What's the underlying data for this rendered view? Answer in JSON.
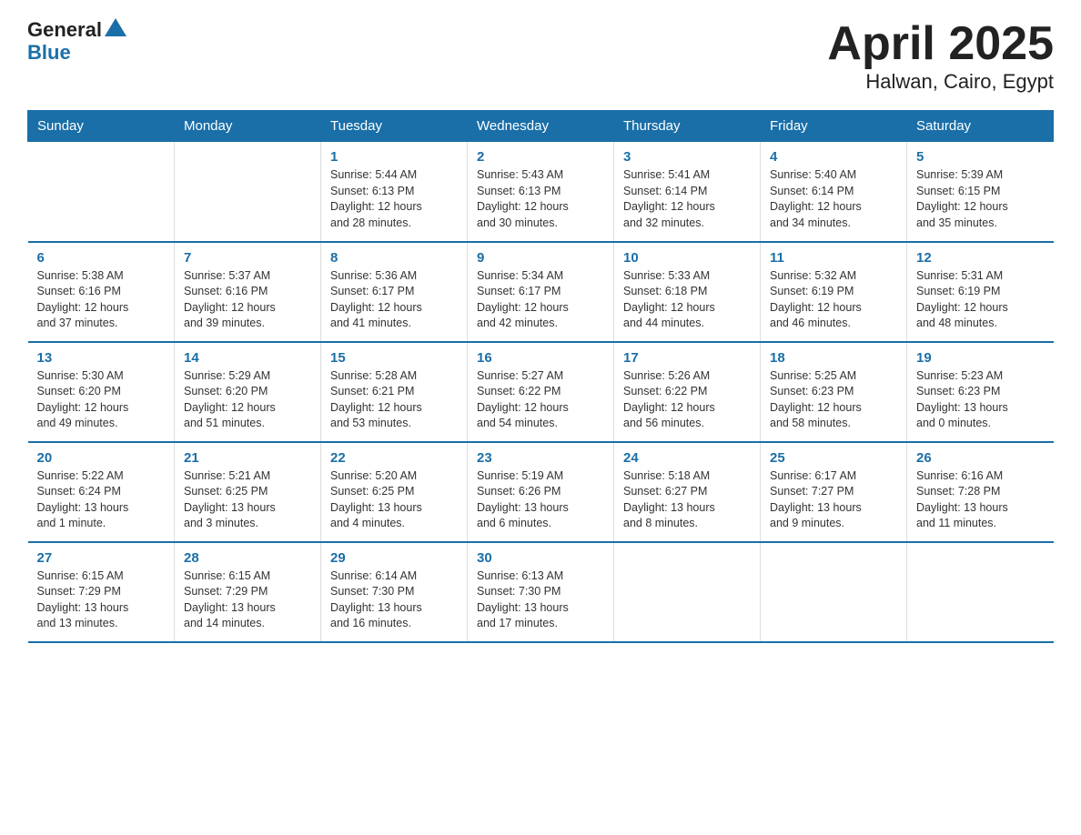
{
  "header": {
    "logo_general": "General",
    "logo_blue": "Blue",
    "title": "April 2025",
    "subtitle": "Halwan, Cairo, Egypt"
  },
  "weekdays": [
    "Sunday",
    "Monday",
    "Tuesday",
    "Wednesday",
    "Thursday",
    "Friday",
    "Saturday"
  ],
  "weeks": [
    [
      {
        "day": "",
        "info": ""
      },
      {
        "day": "",
        "info": ""
      },
      {
        "day": "1",
        "info": "Sunrise: 5:44 AM\nSunset: 6:13 PM\nDaylight: 12 hours\nand 28 minutes."
      },
      {
        "day": "2",
        "info": "Sunrise: 5:43 AM\nSunset: 6:13 PM\nDaylight: 12 hours\nand 30 minutes."
      },
      {
        "day": "3",
        "info": "Sunrise: 5:41 AM\nSunset: 6:14 PM\nDaylight: 12 hours\nand 32 minutes."
      },
      {
        "day": "4",
        "info": "Sunrise: 5:40 AM\nSunset: 6:14 PM\nDaylight: 12 hours\nand 34 minutes."
      },
      {
        "day": "5",
        "info": "Sunrise: 5:39 AM\nSunset: 6:15 PM\nDaylight: 12 hours\nand 35 minutes."
      }
    ],
    [
      {
        "day": "6",
        "info": "Sunrise: 5:38 AM\nSunset: 6:16 PM\nDaylight: 12 hours\nand 37 minutes."
      },
      {
        "day": "7",
        "info": "Sunrise: 5:37 AM\nSunset: 6:16 PM\nDaylight: 12 hours\nand 39 minutes."
      },
      {
        "day": "8",
        "info": "Sunrise: 5:36 AM\nSunset: 6:17 PM\nDaylight: 12 hours\nand 41 minutes."
      },
      {
        "day": "9",
        "info": "Sunrise: 5:34 AM\nSunset: 6:17 PM\nDaylight: 12 hours\nand 42 minutes."
      },
      {
        "day": "10",
        "info": "Sunrise: 5:33 AM\nSunset: 6:18 PM\nDaylight: 12 hours\nand 44 minutes."
      },
      {
        "day": "11",
        "info": "Sunrise: 5:32 AM\nSunset: 6:19 PM\nDaylight: 12 hours\nand 46 minutes."
      },
      {
        "day": "12",
        "info": "Sunrise: 5:31 AM\nSunset: 6:19 PM\nDaylight: 12 hours\nand 48 minutes."
      }
    ],
    [
      {
        "day": "13",
        "info": "Sunrise: 5:30 AM\nSunset: 6:20 PM\nDaylight: 12 hours\nand 49 minutes."
      },
      {
        "day": "14",
        "info": "Sunrise: 5:29 AM\nSunset: 6:20 PM\nDaylight: 12 hours\nand 51 minutes."
      },
      {
        "day": "15",
        "info": "Sunrise: 5:28 AM\nSunset: 6:21 PM\nDaylight: 12 hours\nand 53 minutes."
      },
      {
        "day": "16",
        "info": "Sunrise: 5:27 AM\nSunset: 6:22 PM\nDaylight: 12 hours\nand 54 minutes."
      },
      {
        "day": "17",
        "info": "Sunrise: 5:26 AM\nSunset: 6:22 PM\nDaylight: 12 hours\nand 56 minutes."
      },
      {
        "day": "18",
        "info": "Sunrise: 5:25 AM\nSunset: 6:23 PM\nDaylight: 12 hours\nand 58 minutes."
      },
      {
        "day": "19",
        "info": "Sunrise: 5:23 AM\nSunset: 6:23 PM\nDaylight: 13 hours\nand 0 minutes."
      }
    ],
    [
      {
        "day": "20",
        "info": "Sunrise: 5:22 AM\nSunset: 6:24 PM\nDaylight: 13 hours\nand 1 minute."
      },
      {
        "day": "21",
        "info": "Sunrise: 5:21 AM\nSunset: 6:25 PM\nDaylight: 13 hours\nand 3 minutes."
      },
      {
        "day": "22",
        "info": "Sunrise: 5:20 AM\nSunset: 6:25 PM\nDaylight: 13 hours\nand 4 minutes."
      },
      {
        "day": "23",
        "info": "Sunrise: 5:19 AM\nSunset: 6:26 PM\nDaylight: 13 hours\nand 6 minutes."
      },
      {
        "day": "24",
        "info": "Sunrise: 5:18 AM\nSunset: 6:27 PM\nDaylight: 13 hours\nand 8 minutes."
      },
      {
        "day": "25",
        "info": "Sunrise: 6:17 AM\nSunset: 7:27 PM\nDaylight: 13 hours\nand 9 minutes."
      },
      {
        "day": "26",
        "info": "Sunrise: 6:16 AM\nSunset: 7:28 PM\nDaylight: 13 hours\nand 11 minutes."
      }
    ],
    [
      {
        "day": "27",
        "info": "Sunrise: 6:15 AM\nSunset: 7:29 PM\nDaylight: 13 hours\nand 13 minutes."
      },
      {
        "day": "28",
        "info": "Sunrise: 6:15 AM\nSunset: 7:29 PM\nDaylight: 13 hours\nand 14 minutes."
      },
      {
        "day": "29",
        "info": "Sunrise: 6:14 AM\nSunset: 7:30 PM\nDaylight: 13 hours\nand 16 minutes."
      },
      {
        "day": "30",
        "info": "Sunrise: 6:13 AM\nSunset: 7:30 PM\nDaylight: 13 hours\nand 17 minutes."
      },
      {
        "day": "",
        "info": ""
      },
      {
        "day": "",
        "info": ""
      },
      {
        "day": "",
        "info": ""
      }
    ]
  ]
}
